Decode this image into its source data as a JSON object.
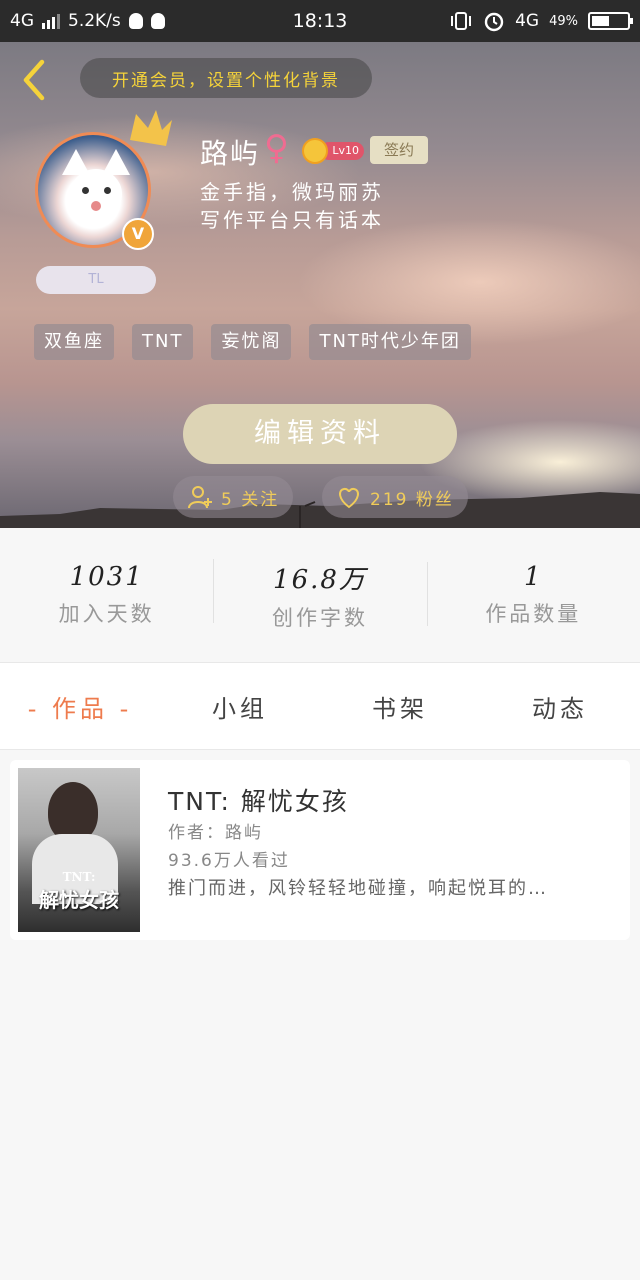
{
  "status_bar": {
    "network": "4G",
    "speed": "5.2K/s",
    "time": "18:13",
    "network_right": "4G",
    "battery": "49%",
    "battery_level": 0.49
  },
  "header": {
    "vip_text": "开通会员，设置个性化背景",
    "name": "路屿",
    "gender_symbol": "♀",
    "level": "Lv10",
    "sign_badge": "签约",
    "bio_line1": "金手指，微玛丽苏",
    "bio_line2": "写作平台只有话本",
    "tl_tag": "TL",
    "v_badge": "V",
    "tags": [
      "双鱼座",
      "TNT",
      "妄忧阁",
      "TNT时代少年团"
    ],
    "edit_button": "编辑资料",
    "following": "5 关注",
    "followers": "219 粉丝"
  },
  "stats": [
    {
      "value": "1031",
      "label": "加入天数"
    },
    {
      "value": "16.8万",
      "label": "创作字数"
    },
    {
      "value": "1",
      "label": "作品数量"
    }
  ],
  "tabs": [
    "- 作品 -",
    "小组",
    "书架",
    "动态"
  ],
  "book": {
    "title": "TNT: 解忧女孩",
    "author": "作者：路屿",
    "views": "93.6万人看过",
    "description": "推门而进，风铃轻轻地碰撞，响起悦耳的…",
    "cover_title": "解忧女孩",
    "cover_tnt": "TNT:"
  },
  "colors": {
    "accent": "#ee7b4d",
    "vip_text": "#f5d33a",
    "follow_text": "#f0cc5a"
  }
}
